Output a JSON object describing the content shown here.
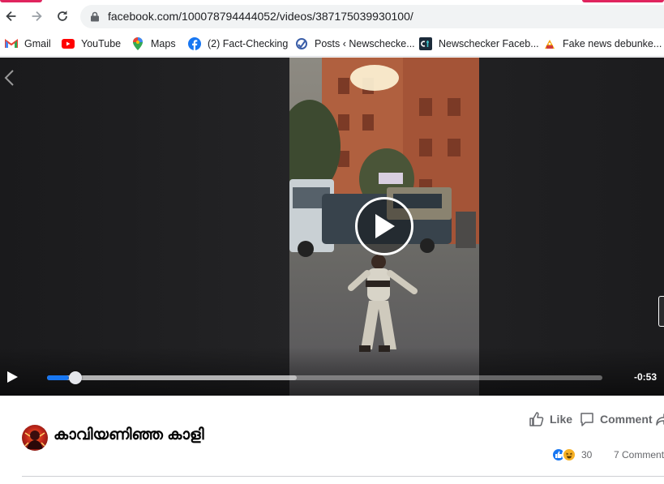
{
  "browser": {
    "url": "facebook.com/100078794444052/videos/387175039930100/",
    "accent_color": "#e0245e"
  },
  "bookmarks": [
    {
      "label": "Gmail",
      "icon": "gmail-icon"
    },
    {
      "label": "YouTube",
      "icon": "youtube-icon"
    },
    {
      "label": "Maps",
      "icon": "maps-icon"
    },
    {
      "label": "(2) Fact-Checking",
      "icon": "facebook-icon"
    },
    {
      "label": "Posts ‹ Newschecke...",
      "icon": "newschecker-icon"
    },
    {
      "label": "Newschecker Faceb...",
      "icon": "ct-icon"
    },
    {
      "label": "Fake news debunke...",
      "icon": "fakenews-icon"
    }
  ],
  "video": {
    "time_remaining": "-0:53",
    "progress_fraction": 0.04,
    "buffered_fraction": 0.45,
    "accent_color": "#1877f2"
  },
  "post": {
    "page_name": "കാവിയണിഞ്ഞ കാളി",
    "like_label": "Like",
    "comment_label": "Comment",
    "reaction_count": "30",
    "comments_count": "7 Comments"
  }
}
